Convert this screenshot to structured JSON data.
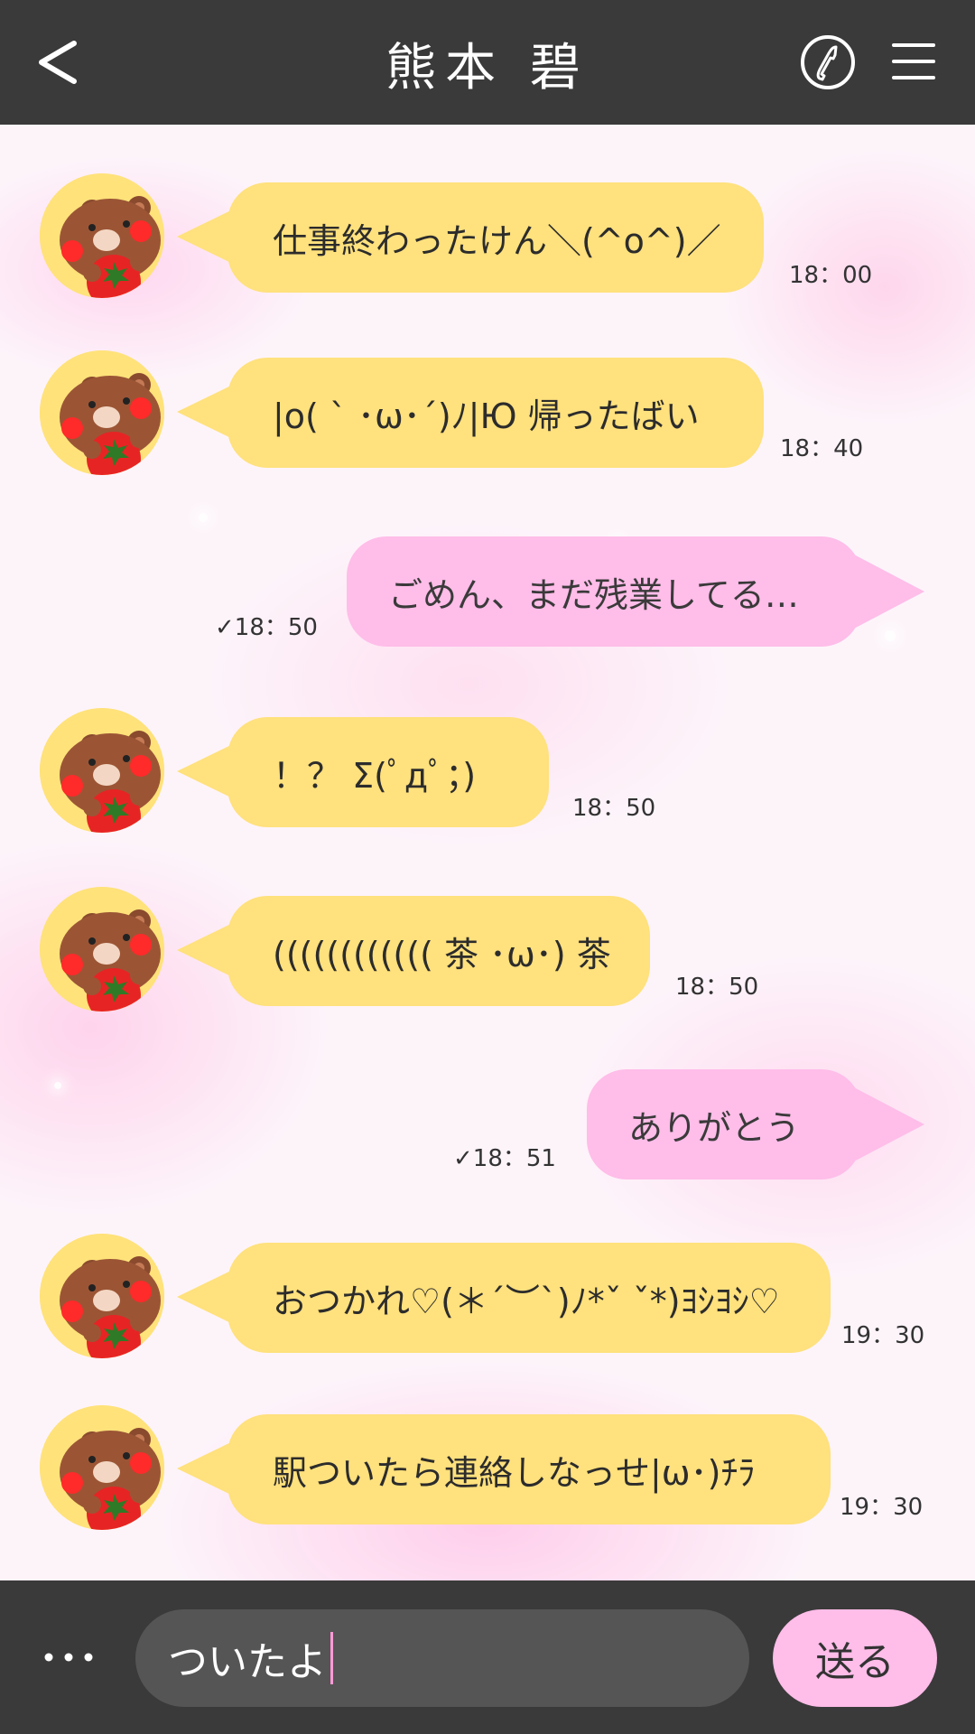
{
  "header": {
    "title": "熊本 碧",
    "back_icon": "chevron-left-icon",
    "call_icon": "phone-icon",
    "menu_icon": "hamburger-menu-icon"
  },
  "colors": {
    "header_bg": "#3a3a3a",
    "incoming_bubble": "#ffe17d",
    "outgoing_bubble": "#ffbde9",
    "background": "#fdf4fa"
  },
  "messages": [
    {
      "side": "in",
      "text": "仕事終わったけん＼(^o^)／",
      "time": "18：00"
    },
    {
      "side": "in",
      "text": "|o( ` ･ω･´)ﾉ|Ю 帰ったばい",
      "time": "18：40"
    },
    {
      "side": "out",
      "text": "ごめん、まだ残業してる…",
      "time": "✓18：50"
    },
    {
      "side": "in",
      "text": "！？ Σ(ﾟдﾟ；)",
      "time": "18：50"
    },
    {
      "side": "in",
      "text": "(((((((((((( 茶 ･ω･) 茶",
      "time": "18：50"
    },
    {
      "side": "out",
      "text": "ありがとう",
      "time": "✓18：51"
    },
    {
      "side": "in",
      "text": "おつかれ♡(＊´︶`)ﾉ*ˇ ˇ*)ﾖｼﾖｼ♡",
      "time": "19：30"
    },
    {
      "side": "in",
      "text": "駅ついたら連絡しなっせ|ω･)ﾁﾗ",
      "time": "19：30"
    }
  ],
  "composer": {
    "more_icon": "ellipsis-icon",
    "input_value": "ついたよ",
    "send_label": "送る"
  }
}
